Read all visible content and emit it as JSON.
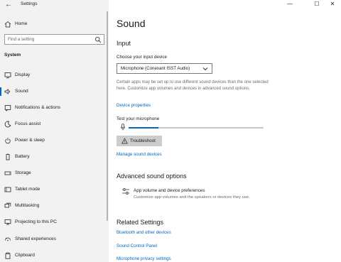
{
  "window": {
    "app_title": "Settings",
    "back_glyph": "←",
    "minimize_glyph": "—",
    "maximize_glyph": "☐",
    "close_glyph": "✕"
  },
  "sidebar": {
    "home_label": "Home",
    "search_placeholder": "Find a setting",
    "section_title": "System",
    "items": [
      {
        "label": "Display",
        "icon": "display-icon"
      },
      {
        "label": "Sound",
        "icon": "speaker-icon",
        "active": true
      },
      {
        "label": "Notifications & actions",
        "icon": "notifications-icon"
      },
      {
        "label": "Focus assist",
        "icon": "moon-icon"
      },
      {
        "label": "Power & sleep",
        "icon": "power-icon"
      },
      {
        "label": "Battery",
        "icon": "battery-icon"
      },
      {
        "label": "Storage",
        "icon": "storage-icon"
      },
      {
        "label": "Tablet mode",
        "icon": "tablet-icon"
      },
      {
        "label": "Multitasking",
        "icon": "multitasking-icon"
      },
      {
        "label": "Projecting to this PC",
        "icon": "projecting-icon"
      },
      {
        "label": "Shared experiences",
        "icon": "shared-icon"
      },
      {
        "label": "Clipboard",
        "icon": "clipboard-icon"
      }
    ]
  },
  "main": {
    "title": "Sound",
    "input": {
      "heading": "Input",
      "choose_label": "Choose your input device",
      "device_value": "Microphone (Conexant ISST Audio)",
      "description": "Certain apps may be set up to use different sound devices than the one selected here. Customize app volumes and devices in advanced sound options.",
      "device_properties_link": "Device properties",
      "test_label": "Test your microphone",
      "mic_level": 0.22,
      "troubleshoot_label": "Troubleshoot",
      "manage_link": "Manage sound devices"
    },
    "advanced": {
      "heading": "Advanced sound options",
      "option_title": "App volume and device preferences",
      "option_sub": "Customize app volumes and the speakers or devices they use."
    },
    "related": {
      "heading": "Related Settings",
      "links": [
        "Bluetooth and other devices",
        "Sound Control Panel",
        "Microphone privacy settings"
      ]
    }
  },
  "colors": {
    "accent": "#0067c0",
    "sidebar_bg": "#f2f2f2",
    "button_bg": "#cccccc"
  }
}
